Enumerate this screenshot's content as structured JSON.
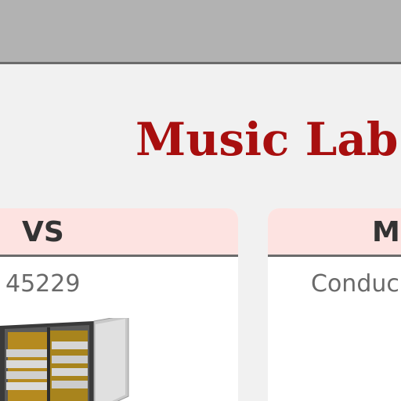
{
  "header": {
    "title": "Music Lab"
  },
  "cards": [
    {
      "label": "VS",
      "value": "45229",
      "image_icon": "storage-cabinet-image"
    },
    {
      "label": "M",
      "value": "Conduc"
    }
  ],
  "colors": {
    "top_bar": "#b2b2b2",
    "title": "#a80f0f",
    "card_header": "#fde3e1",
    "background": "#f1f1f1"
  }
}
